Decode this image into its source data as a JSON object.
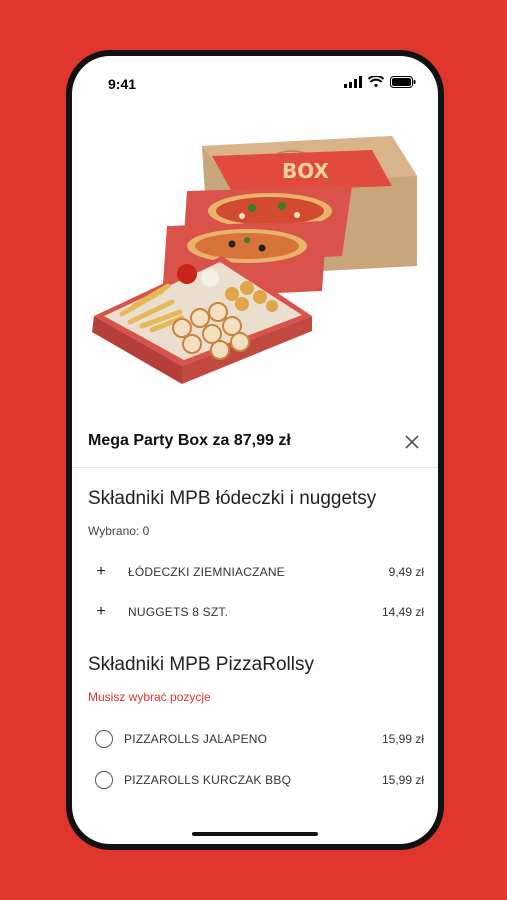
{
  "status": {
    "time": "9:41"
  },
  "product": {
    "title": "Mega Party Box za 87,99 zł",
    "box_text": "BOX"
  },
  "section1": {
    "title": "Składniki MPB łódeczki i nuggetsy",
    "subtitle": "Wybrano: 0",
    "items": [
      {
        "label": "ŁÓDECZKI ZIEMNIACZANE",
        "price": "9,49 zł"
      },
      {
        "label": "NUGGETS 8 SZT.",
        "price": "14,49 zł"
      }
    ]
  },
  "section2": {
    "title": "Składniki MPB PizzaRollsy",
    "subtitle": "Musisz wybrać pozycje",
    "items": [
      {
        "label": "PIZZAROLLS JALAPENO",
        "price": "15,99 zł"
      },
      {
        "label": "PIZZAROLLS KURCZAK BBQ",
        "price": "15,99 zł"
      }
    ]
  },
  "colors": {
    "background": "#e0352d",
    "warning": "#e0352d",
    "box": "#d9534a",
    "kraft": "#c9a57c"
  },
  "icons": [
    "signal-icon",
    "wifi-icon",
    "battery-icon",
    "close-icon",
    "plus-icon",
    "radio-icon"
  ]
}
